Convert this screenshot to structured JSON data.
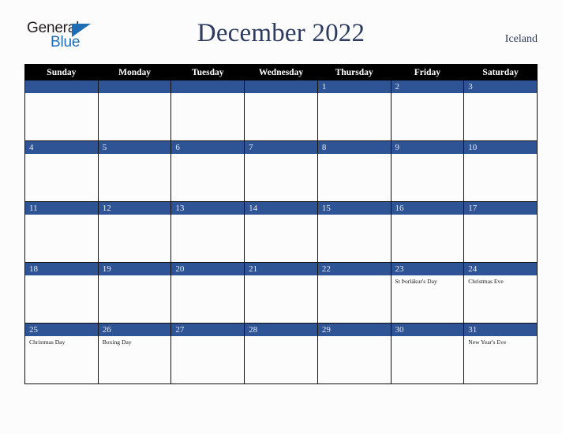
{
  "brand": {
    "name_part1": "General",
    "name_part2": "Blue",
    "triangle_color": "#1f6db5",
    "text_color": "#231f20"
  },
  "header": {
    "title": "December 2022",
    "country": "Iceland",
    "title_color": "#2d3c5e"
  },
  "calendar": {
    "weekday_headers": [
      "Sunday",
      "Monday",
      "Tuesday",
      "Wednesday",
      "Thursday",
      "Friday",
      "Saturday"
    ],
    "header_bg": "#000000",
    "header_text": "#ffffff",
    "daybar_bg": "#2f5496",
    "daybar_text": "#e8ecf5",
    "weeks": [
      [
        {
          "day": "",
          "events": []
        },
        {
          "day": "",
          "events": []
        },
        {
          "day": "",
          "events": []
        },
        {
          "day": "",
          "events": []
        },
        {
          "day": "1",
          "events": []
        },
        {
          "day": "2",
          "events": []
        },
        {
          "day": "3",
          "events": []
        }
      ],
      [
        {
          "day": "4",
          "events": []
        },
        {
          "day": "5",
          "events": []
        },
        {
          "day": "6",
          "events": []
        },
        {
          "day": "7",
          "events": []
        },
        {
          "day": "8",
          "events": []
        },
        {
          "day": "9",
          "events": []
        },
        {
          "day": "10",
          "events": []
        }
      ],
      [
        {
          "day": "11",
          "events": []
        },
        {
          "day": "12",
          "events": []
        },
        {
          "day": "13",
          "events": []
        },
        {
          "day": "14",
          "events": []
        },
        {
          "day": "15",
          "events": []
        },
        {
          "day": "16",
          "events": []
        },
        {
          "day": "17",
          "events": []
        }
      ],
      [
        {
          "day": "18",
          "events": []
        },
        {
          "day": "19",
          "events": []
        },
        {
          "day": "20",
          "events": []
        },
        {
          "day": "21",
          "events": []
        },
        {
          "day": "22",
          "events": []
        },
        {
          "day": "23",
          "events": [
            "St Þorlákur's Day"
          ]
        },
        {
          "day": "24",
          "events": [
            "Christmas Eve"
          ]
        }
      ],
      [
        {
          "day": "25",
          "events": [
            "Christmas Day"
          ]
        },
        {
          "day": "26",
          "events": [
            "Boxing Day"
          ]
        },
        {
          "day": "27",
          "events": []
        },
        {
          "day": "28",
          "events": []
        },
        {
          "day": "29",
          "events": []
        },
        {
          "day": "30",
          "events": []
        },
        {
          "day": "31",
          "events": [
            "New Year's Eve"
          ]
        }
      ]
    ]
  }
}
